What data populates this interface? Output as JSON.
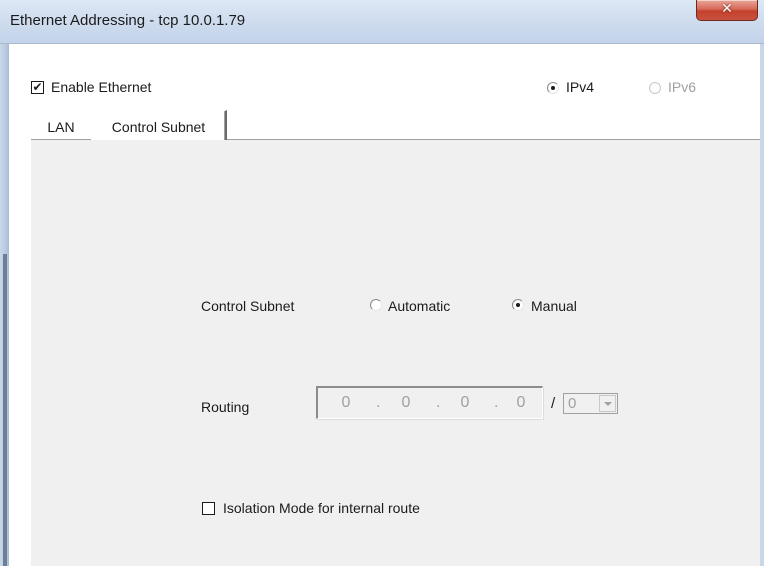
{
  "window": {
    "title": "Ethernet Addressing - tcp 10.0.1.79",
    "close_glyph": "✕"
  },
  "enable_ethernet": {
    "label": "Enable Ethernet",
    "checked": true,
    "check_glyph": "✔"
  },
  "ip_version": {
    "ipv4_label": "IPv4",
    "ipv6_label": "IPv6",
    "selected": "IPv4",
    "ipv6_enabled": false
  },
  "tabs": [
    {
      "label": "LAN",
      "active": false
    },
    {
      "label": "Control Subnet",
      "active": true
    }
  ],
  "control_subnet": {
    "label": "Control Subnet",
    "automatic_label": "Automatic",
    "manual_label": "Manual",
    "selected": "Manual"
  },
  "routing": {
    "label": "Routing",
    "octets": [
      "0",
      "0",
      "0",
      "0"
    ],
    "dot": ".",
    "slash": "/",
    "prefix": "0",
    "enabled": false
  },
  "isolation_mode": {
    "label": "Isolation Mode for internal route",
    "checked": false
  },
  "colors": {
    "panel_bg": "#f0f0f0",
    "disabled_text": "#a0a0a0",
    "close_red": "#c4412d",
    "titlebar_blue": "#cfdcee"
  },
  "icons": {
    "close": "close-icon",
    "dropdown": "chevron-down-icon"
  }
}
